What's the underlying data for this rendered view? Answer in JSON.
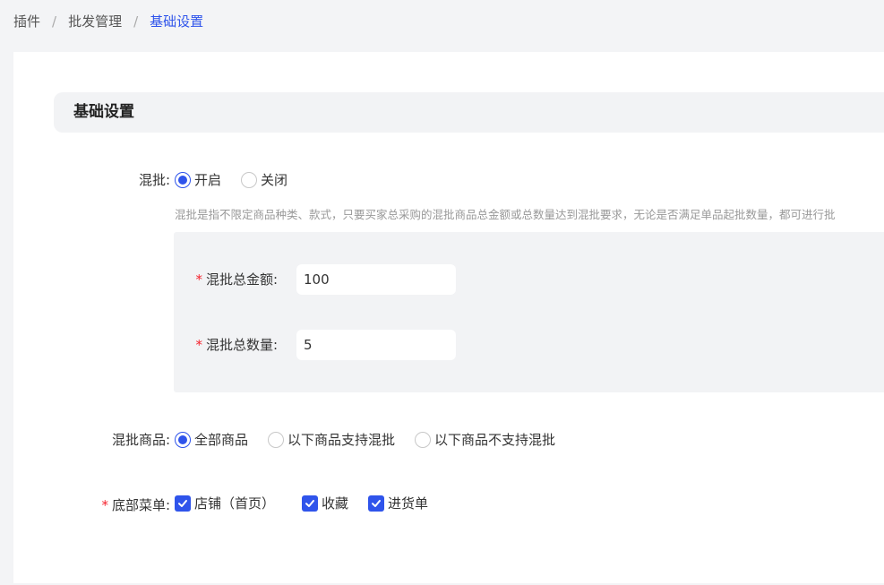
{
  "breadcrumb": {
    "items": [
      "插件",
      "批发管理",
      "基础设置"
    ],
    "separator": "/"
  },
  "section": {
    "title": "基础设置"
  },
  "mixed_batch": {
    "label": "混批:",
    "options": [
      "开启",
      "关闭"
    ],
    "selected": "开启",
    "hint": "混批是指不限定商品种类、款式，只要买家总采购的混批商品总金额或总数量达到混批要求，无论是否满足单品起批数量，都可进行批"
  },
  "sub_settings": {
    "total_amount": {
      "label": "混批总金额:",
      "value": "100",
      "required": true
    },
    "total_quantity": {
      "label": "混批总数量:",
      "value": "5",
      "required": true
    }
  },
  "mixed_goods": {
    "label": "混批商品:",
    "options": [
      "全部商品",
      "以下商品支持混批",
      "以下商品不支持混批"
    ],
    "selected": "全部商品"
  },
  "bottom_menu": {
    "label": "底部菜单:",
    "required": true,
    "options": [
      {
        "label": "店铺（首页）",
        "checked": true
      },
      {
        "label": "收藏",
        "checked": true
      },
      {
        "label": "进货单",
        "checked": true
      }
    ]
  },
  "colors": {
    "accent": "#2f54eb",
    "required": "#f5222d"
  },
  "icons": {
    "checkbox": "checkmark-icon"
  }
}
